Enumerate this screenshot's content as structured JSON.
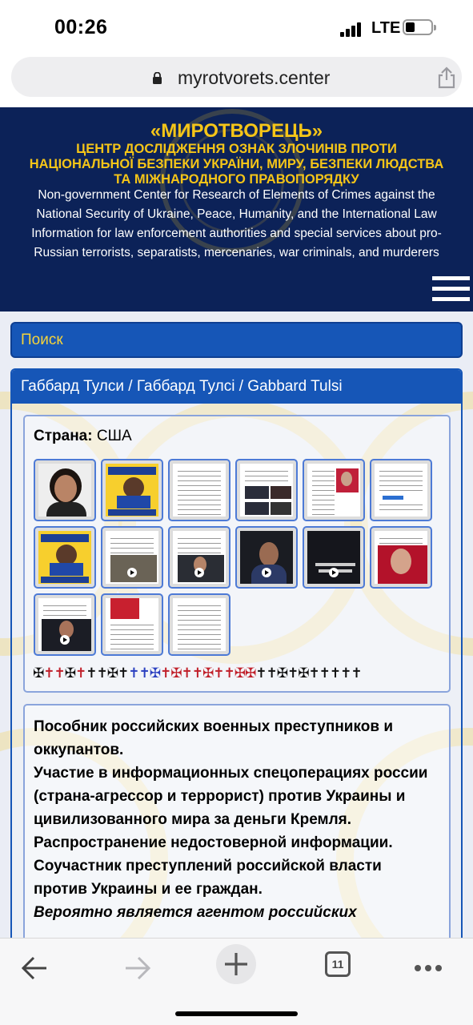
{
  "status_bar": {
    "time": "00:26",
    "network": "LTE"
  },
  "browser": {
    "url": "myrotvorets.center",
    "tabs_count": "11"
  },
  "banner": {
    "title": "«МИРОТВОРЕЦЬ»",
    "subtitle": "ЦЕНТР ДОСЛІДЖЕННЯ ОЗНАК ЗЛОЧИНІВ ПРОТИ НАЦІОНАЛЬНОЇ БЕЗПЕКИ УКРАЇНИ, МИРУ, БЕЗПЕКИ ЛЮДСТВА ТА МІЖНАРОДНОГО ПРАВОПОРЯДКУ",
    "english_lines": [
      "Non-government Center for Research of Elements of Crimes against the",
      "National Security of Ukraine, Peace, Humanity, and the International Law",
      "Information for law enforcement authorities and special services about pro-",
      "Russian terrorists, separatists, mercenaries, war criminals, and murderers"
    ]
  },
  "search": {
    "label": "Поиск"
  },
  "person": {
    "name": "Габбард Тулси / Габбард Тулсі / Gabbard Tulsi",
    "country_label": "Страна:",
    "country_value": "США",
    "crosses": "✠✝✝✠✝✝✠✝✝✠✝✝✠✝✝✠✝✝✠✝✝✠✝✝✠✝✝✠✝✠✝✝✝✝✝",
    "thumbnails": [
      {
        "type": "portrait"
      },
      {
        "type": "yellow"
      },
      {
        "type": "doc"
      },
      {
        "type": "dark"
      },
      {
        "type": "dark"
      },
      {
        "type": "doc"
      },
      {
        "type": "yellow"
      },
      {
        "type": "video-doc"
      },
      {
        "type": "video-doc"
      },
      {
        "type": "dark-video"
      },
      {
        "type": "dark-video"
      },
      {
        "type": "portrait-red"
      },
      {
        "type": "dark-video"
      },
      {
        "type": "doc-red"
      },
      {
        "type": "doc"
      }
    ],
    "description": [
      "Пособник российских военных преступников и оккупантов.",
      "Участие в информационных спецоперациях россии (страна-агрессор и террорист) против Украины и цивилизованного мира за деньги Кремля. Распространение недостоверной информации.",
      "Соучастник преступлений российской власти против Украины и ее граждан."
    ],
    "description_italic": "Вероятно является агентом российских"
  },
  "icons": {
    "lock": "lock-icon",
    "share": "share-icon",
    "menu": "hamburger-menu-icon",
    "back": "back-arrow-icon",
    "forward": "forward-arrow-icon",
    "new_tab": "plus-icon",
    "more": "more-dots-icon"
  }
}
